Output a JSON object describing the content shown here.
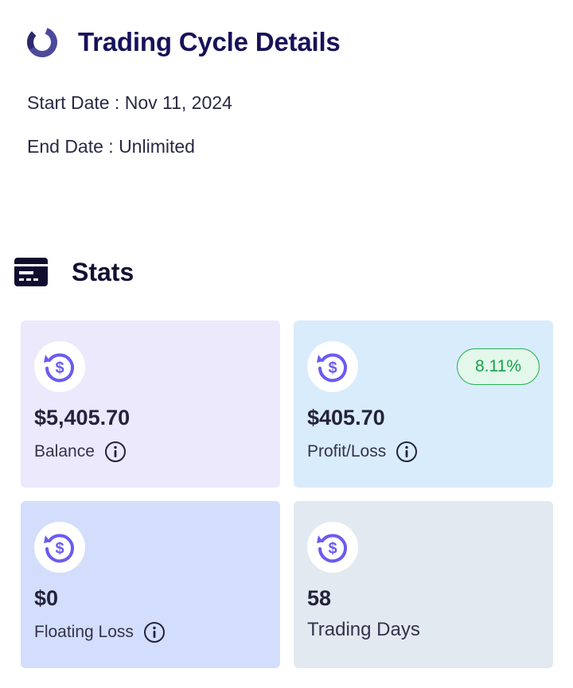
{
  "cycle": {
    "title": "Trading Cycle Details",
    "start_date": "Start Date : Nov 11, 2024",
    "end_date": "End Date : Unlimited",
    "icon": "cycle-ring-icon"
  },
  "stats": {
    "title": "Stats",
    "icon": "stats-card-icon",
    "cards": [
      {
        "value": "$5,405.70",
        "label": "Balance",
        "icon": "dollar-refresh-icon",
        "has_info": true
      },
      {
        "value": "$405.70",
        "label": "Profit/Loss",
        "icon": "dollar-refresh-icon",
        "has_info": true,
        "badge": "8.11%"
      },
      {
        "value": "$0",
        "label": "Floating Loss",
        "icon": "dollar-refresh-icon",
        "has_info": true
      },
      {
        "value": "58",
        "label": "Trading Days",
        "icon": "dollar-refresh-icon",
        "has_info": false
      }
    ]
  },
  "colors": {
    "title": "#16125a",
    "icon_accent": "#6b5bf0",
    "badge_green": "#16a34a",
    "card_balance": "#ece9fd",
    "card_profit": "#d9ecfb",
    "card_floating": "#d3defc",
    "card_days": "#e3e9f0"
  }
}
